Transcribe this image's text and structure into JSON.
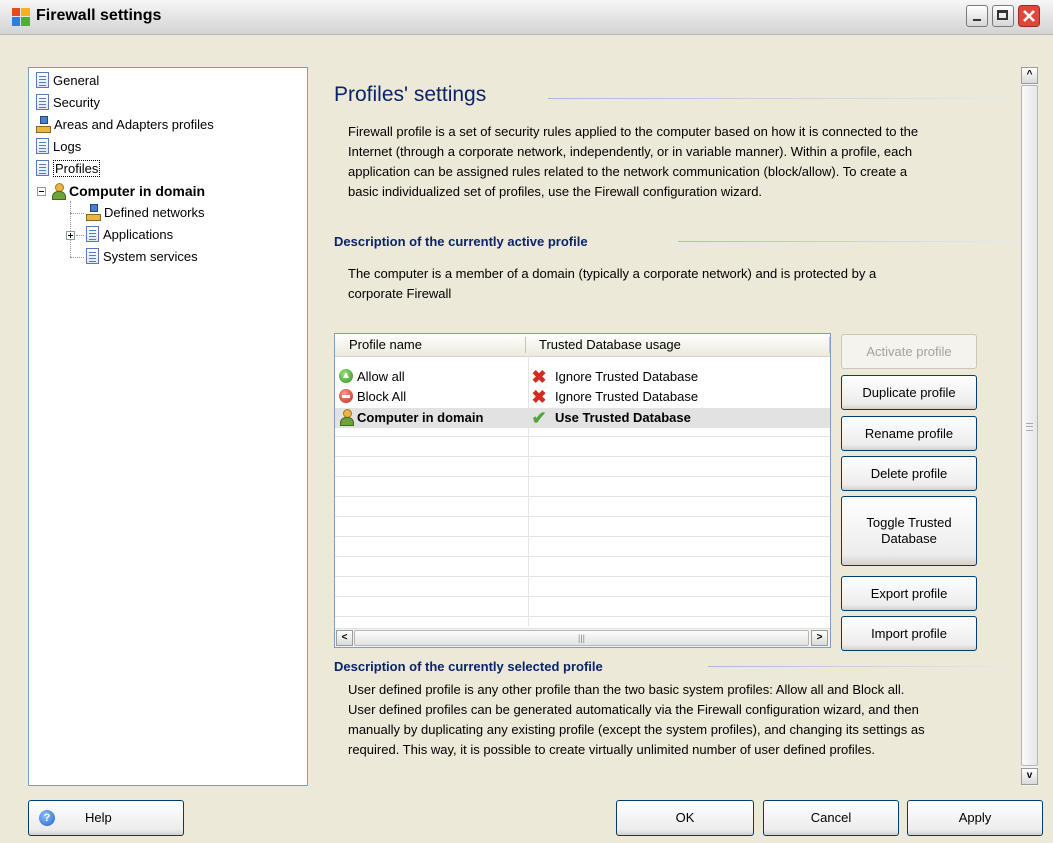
{
  "window": {
    "title": "Firewall settings"
  },
  "tree": {
    "items": [
      {
        "label": "General"
      },
      {
        "label": "Security"
      },
      {
        "label": "Areas and Adapters profiles"
      },
      {
        "label": "Logs"
      },
      {
        "label": "Profiles"
      },
      {
        "label": "Computer in domain"
      },
      {
        "label": "Defined networks"
      },
      {
        "label": "Applications"
      },
      {
        "label": "System services"
      }
    ]
  },
  "content": {
    "title": "Profiles' settings",
    "intro": [
      "Firewall profile is a set of security rules applied to the computer based on how it is connected to the",
      "Internet (through a corporate network, independently, or in variable manner). Within a profile, each",
      "application can be assigned rules related to the network communication (block/allow). To create a",
      "basic individualized set of profiles, use the Firewall configuration wizard."
    ],
    "active_heading": "Description of the currently active profile",
    "active_text": [
      "The computer is a member of a domain (typically a corporate network) and is protected by a",
      "corporate Firewall"
    ],
    "table": {
      "columns": [
        "Profile name",
        "Trusted Database usage"
      ],
      "rows": [
        {
          "name": "Allow all",
          "usage": "Ignore Trusted Database",
          "name_icon": "allow-icon",
          "usage_icon": "x-icon"
        },
        {
          "name": "Block All",
          "usage": "Ignore Trusted Database",
          "name_icon": "block-icon",
          "usage_icon": "x-icon"
        },
        {
          "name": "Computer in domain",
          "usage": "Use Trusted Database",
          "name_icon": "user-icon",
          "usage_icon": "check-icon",
          "selected": true
        }
      ]
    },
    "buttons": {
      "activate": "Activate profile",
      "duplicate": "Duplicate profile",
      "rename": "Rename profile",
      "delete": "Delete profile",
      "toggle": "Toggle Trusted Database",
      "export": "Export profile",
      "import": "Import profile"
    },
    "selected_heading": "Description of the currently selected profile",
    "selected_text": [
      "User defined profile is any other profile than the two basic system profiles: Allow all and Block all.",
      "User defined profiles can be generated automatically via the Firewall configuration wizard, and then",
      "manually by duplicating any existing profile (except the system profiles), and changing its settings as",
      "required. This way, it is possible to create virtually unlimited number of user defined profiles."
    ]
  },
  "footer": {
    "help": "Help",
    "ok": "OK",
    "cancel": "Cancel",
    "apply": "Apply"
  }
}
